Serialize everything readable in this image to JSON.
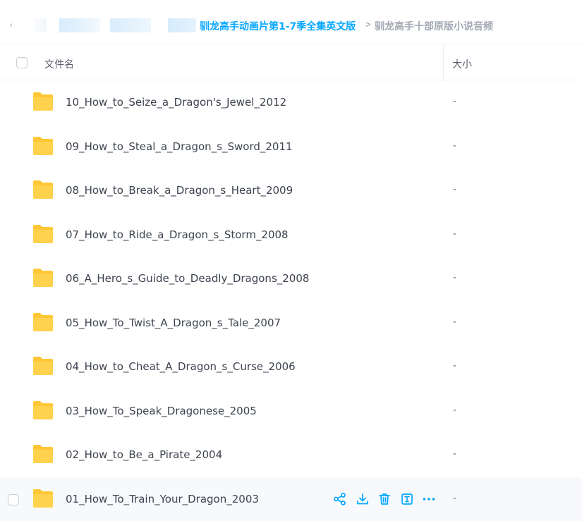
{
  "breadcrumb": {
    "back_icon": "chevron-left-icon",
    "parent_folder": "驯龙高手动画片第1-7季全集英文版",
    "separator": ">",
    "current_folder": "驯龙高手十部原版小说音频"
  },
  "table": {
    "col_name": "文件名",
    "col_size": "大小"
  },
  "rows": [
    {
      "name": "10_How_to_Seize_a_Dragon's_Jewel_2012",
      "size": "-"
    },
    {
      "name": "09_How_to_Steal_a_Dragon_s_Sword_2011",
      "size": "-"
    },
    {
      "name": "08_How_to_Break_a_Dragon_s_Heart_2009",
      "size": "-"
    },
    {
      "name": "07_How_to_Ride_a_Dragon_s_Storm_2008",
      "size": "-"
    },
    {
      "name": "06_A_Hero_s_Guide_to_Deadly_Dragons_2008",
      "size": "-"
    },
    {
      "name": "05_How_To_Twist_A_Dragon_s_Tale_2007",
      "size": "-"
    },
    {
      "name": "04_How_to_Cheat_A_Dragon_s_Curse_2006",
      "size": "-"
    },
    {
      "name": "03_How_To_Speak_Dragonese_2005",
      "size": "-"
    },
    {
      "name": "02_How_to_Be_a_Pirate_2004",
      "size": "-"
    },
    {
      "name": "01_How_To_Train_Your_Dragon_2003",
      "size": "-"
    }
  ],
  "row_actions": [
    "share-icon",
    "download-icon",
    "delete-icon",
    "rename-icon",
    "more-icon"
  ],
  "colors": {
    "accent": "#06a7ff",
    "folder": "#ffc636",
    "hover_row": "#f7f9fc"
  }
}
